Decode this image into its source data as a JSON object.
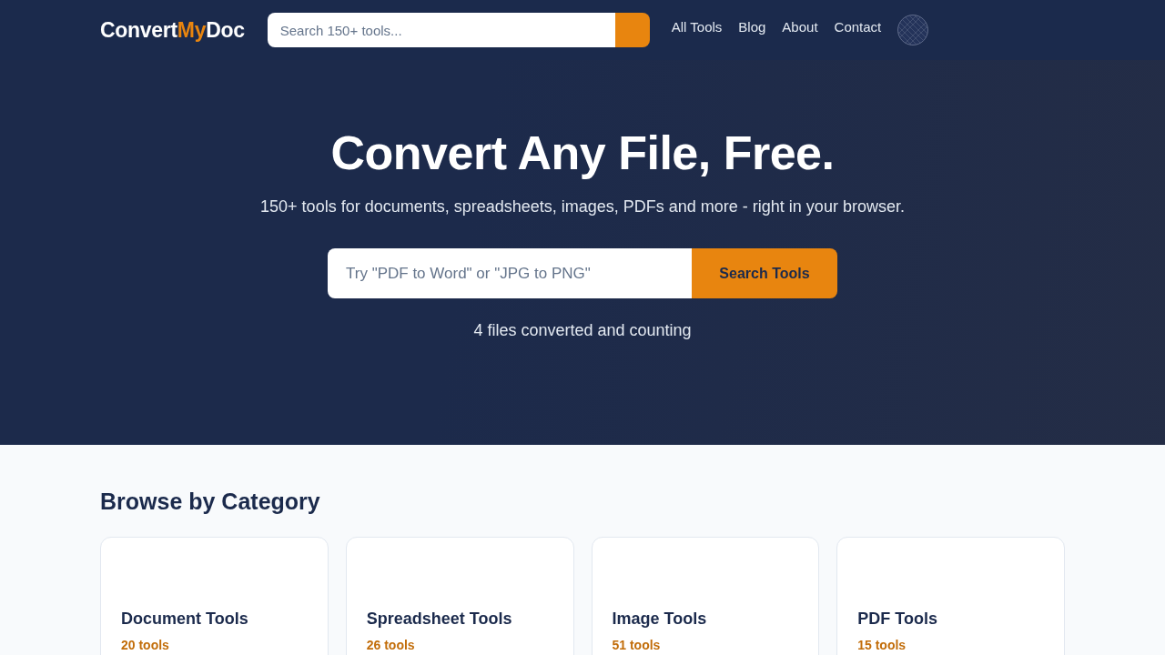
{
  "header": {
    "logo": [
      {
        "text": "Convert",
        "accent": false
      },
      {
        "text": "My",
        "accent": true
      },
      {
        "text": "Doc",
        "accent": false
      }
    ],
    "search": {
      "placeholder": "Search 150+ tools..."
    },
    "nav": [
      {
        "label": "All Tools"
      },
      {
        "label": "Blog"
      },
      {
        "label": "About"
      },
      {
        "label": "Contact"
      }
    ]
  },
  "hero": {
    "title": "Convert Any File, Free.",
    "subtitle": "150+ tools for documents, spreadsheets, images, PDFs and more - right in your browser.",
    "search": {
      "placeholder": "Try \"PDF to Word\" or \"JPG to PNG\"",
      "button": "Search Tools"
    },
    "counter": "4 files converted and counting"
  },
  "categories": {
    "title": "Browse by Category",
    "cards": [
      {
        "name": "Document Tools",
        "count": "20 tools"
      },
      {
        "name": "Spreadsheet Tools",
        "count": "26 tools"
      },
      {
        "name": "Image Tools",
        "count": "51 tools"
      },
      {
        "name": "PDF Tools",
        "count": "15 tools"
      }
    ]
  }
}
